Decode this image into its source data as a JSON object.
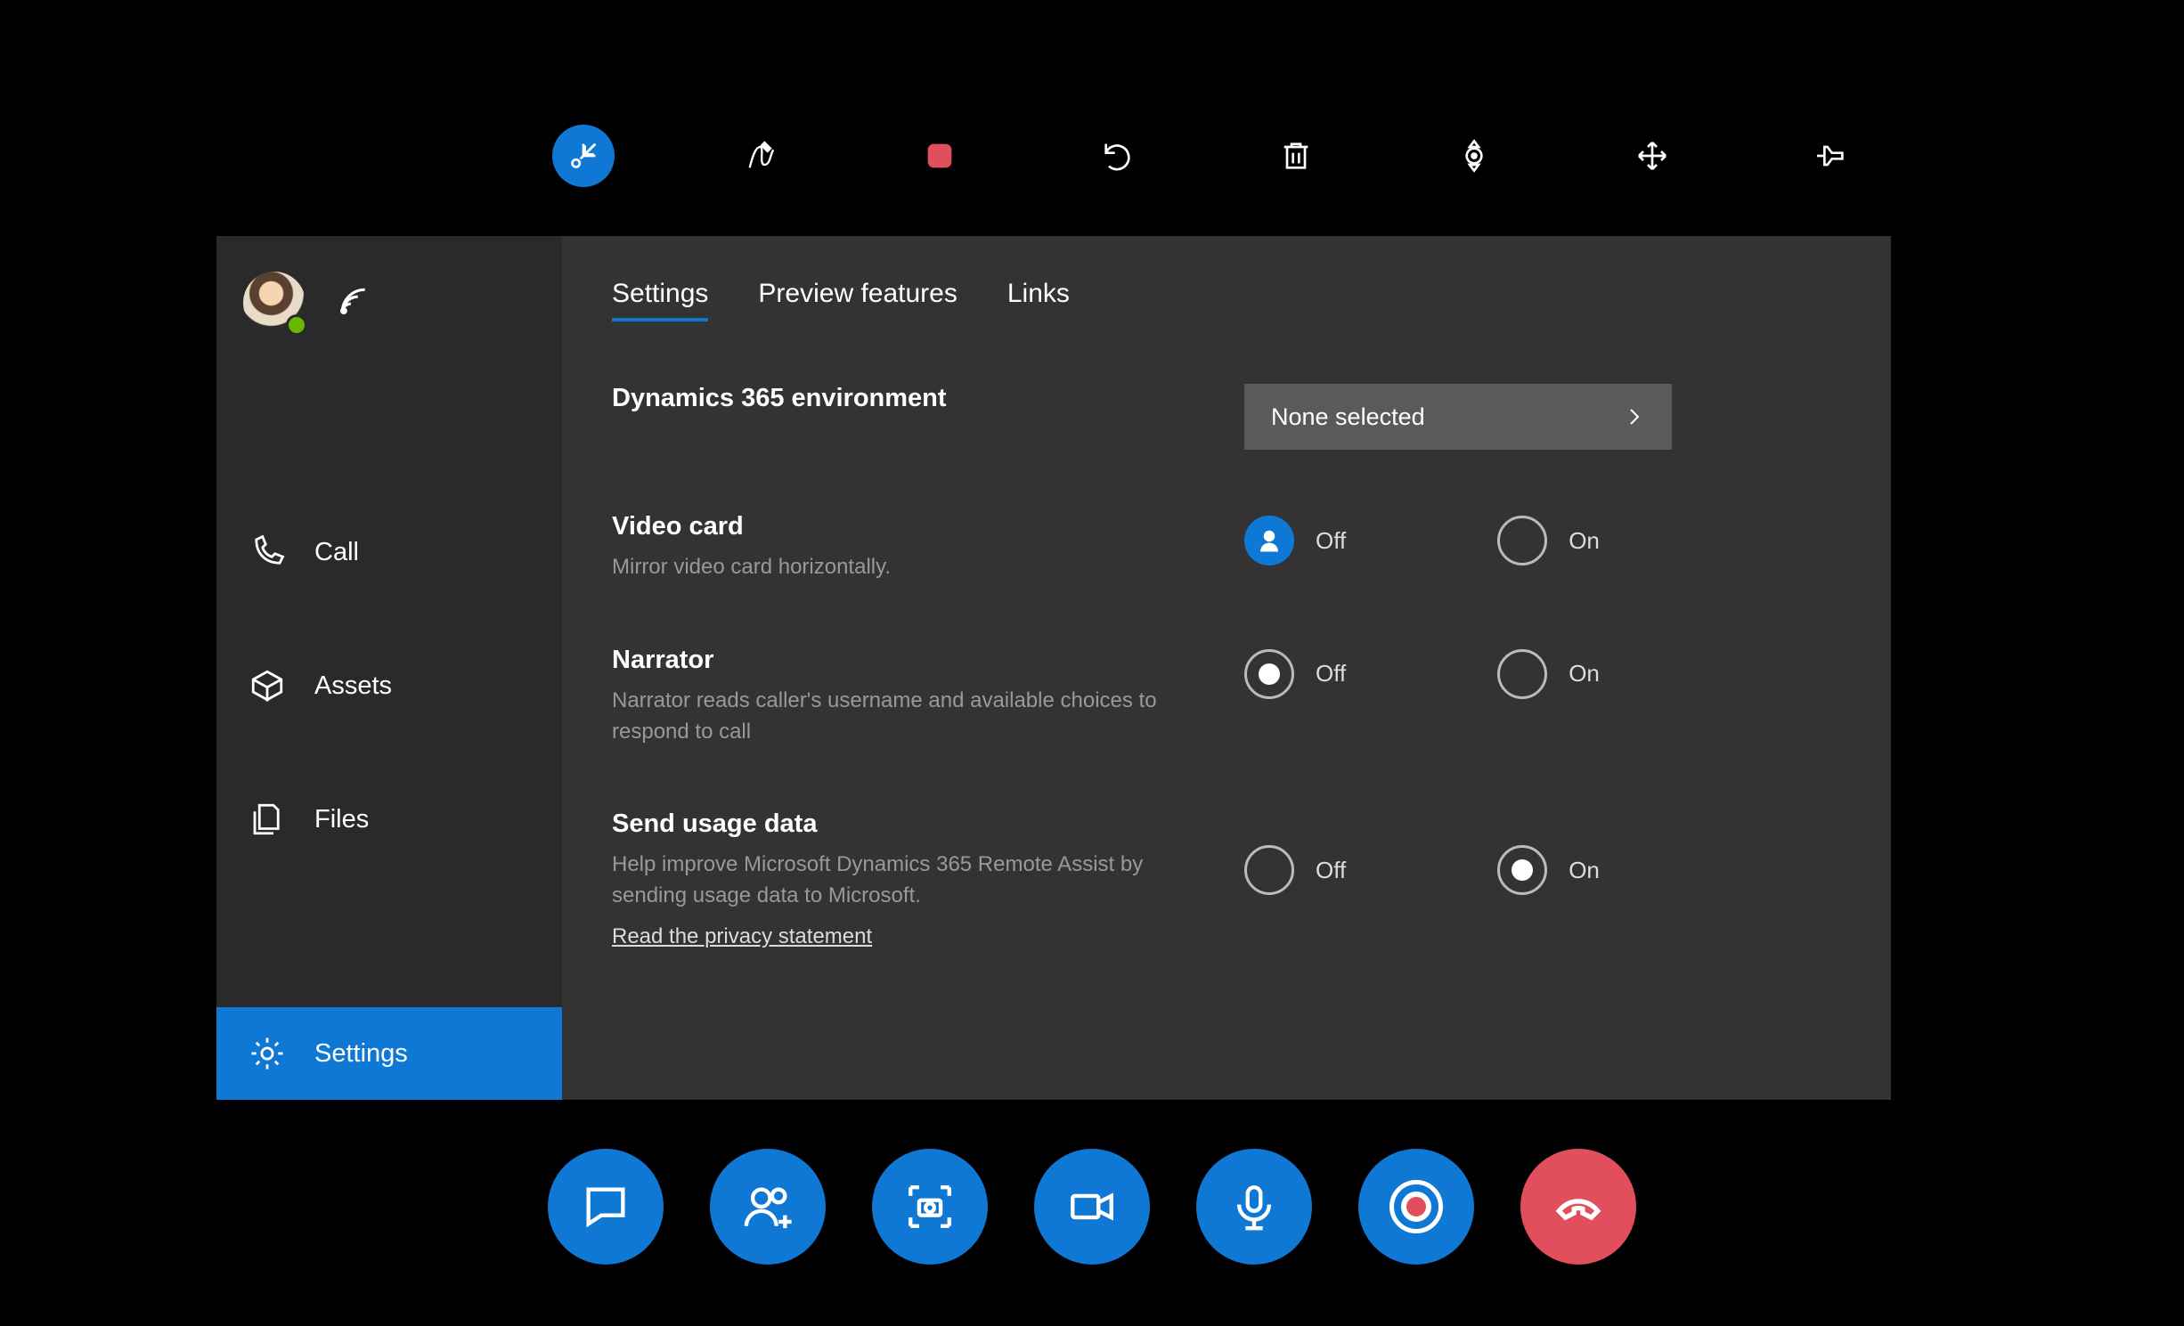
{
  "sidebar": {
    "items": [
      {
        "label": "Call"
      },
      {
        "label": "Assets"
      },
      {
        "label": "Files"
      }
    ],
    "settings_label": "Settings"
  },
  "tabs": {
    "settings": "Settings",
    "preview": "Preview features",
    "links": "Links"
  },
  "rows": {
    "env": {
      "title": "Dynamics 365 environment",
      "value": "None selected"
    },
    "video": {
      "title": "Video card",
      "desc": "Mirror video card horizontally.",
      "off": "Off",
      "on": "On"
    },
    "narrator": {
      "title": "Narrator",
      "desc": "Narrator reads caller's username and available choices to respond to call",
      "off": "Off",
      "on": "On"
    },
    "usage": {
      "title": "Send usage data",
      "desc": "Help improve Microsoft Dynamics 365 Remote Assist by sending usage data to Microsoft.",
      "link": "Read the privacy statement",
      "off": "Off",
      "on": "On"
    }
  }
}
